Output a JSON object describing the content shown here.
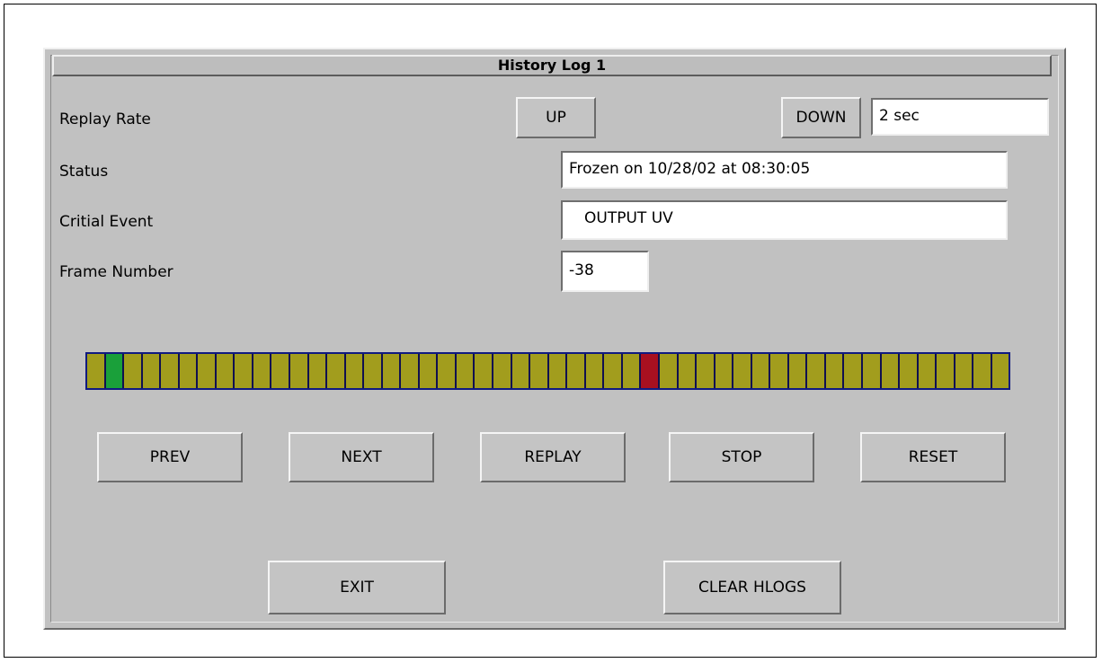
{
  "window": {
    "title": "History Log 1"
  },
  "replay_rate": {
    "label": "Replay Rate",
    "up_label": "UP",
    "down_label": "DOWN",
    "value": "2 sec"
  },
  "status": {
    "label": "Status",
    "value": "Frozen on 10/28/02 at 08:30:05"
  },
  "critical_event": {
    "label": "Critial Event",
    "value": "OUTPUT UV"
  },
  "frame_number": {
    "label": "Frame Number",
    "value": "-38"
  },
  "frame_track": {
    "cell_count": 50,
    "current_cell_index": 1,
    "marker_cell_index": 30,
    "colors": {
      "cell": "#a29d1d",
      "current": "#1aa03a",
      "marker": "#a81020",
      "border": "#101a80"
    }
  },
  "controls": {
    "prev": "PREV",
    "next": "NEXT",
    "replay": "REPLAY",
    "stop": "STOP",
    "reset": "RESET"
  },
  "footer": {
    "exit": "EXIT",
    "clear_hlogs": "CLEAR HLOGS"
  }
}
